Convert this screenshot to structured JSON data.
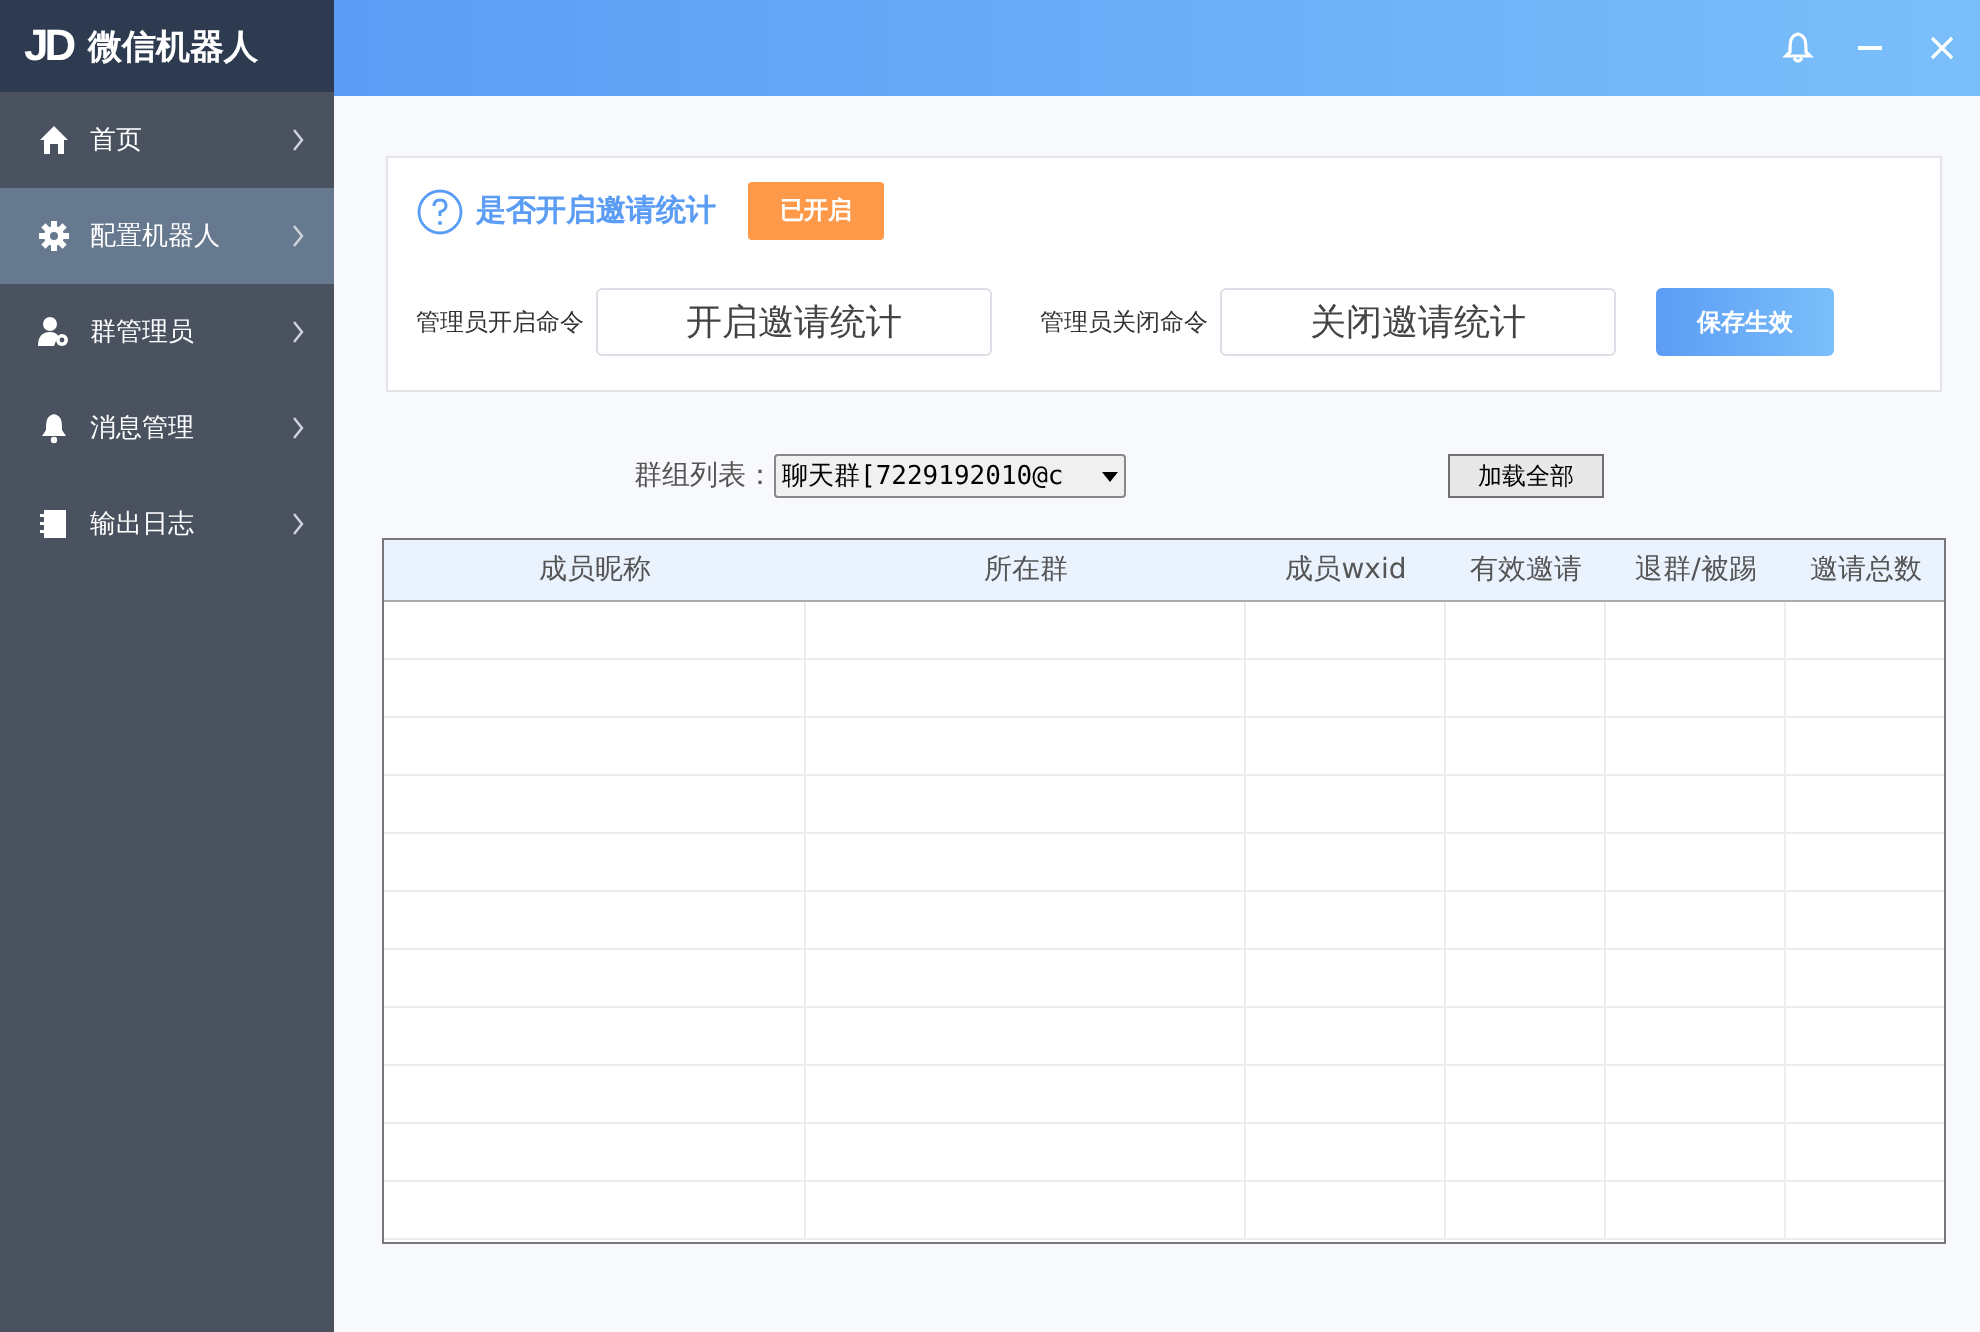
{
  "app": {
    "title": "微信机器人",
    "logo": "JD"
  },
  "sidebar": {
    "items": [
      {
        "label": "首页",
        "selected": false
      },
      {
        "label": "配置机器人",
        "selected": true
      },
      {
        "label": "群管理员",
        "selected": false
      },
      {
        "label": "消息管理",
        "selected": false
      },
      {
        "label": "输出日志",
        "selected": false
      }
    ]
  },
  "invite_panel": {
    "title": "是否开启邀请统计",
    "status": {
      "label": "已开启",
      "on": true
    },
    "open_label": "管理员开启命令",
    "open_value": "开启邀请统计",
    "close_label": "管理员关闭命令",
    "close_value": "关闭邀请统计",
    "save": "保存生效"
  },
  "group_filter": {
    "label": "群组列表：",
    "value": "聊天群[7229192010@c",
    "load_all": "加载全部"
  },
  "table": {
    "columns": [
      "成员昵称",
      "所在群",
      "成员wxid",
      "有效邀请",
      "退群/被踢",
      "邀请总数"
    ]
  }
}
